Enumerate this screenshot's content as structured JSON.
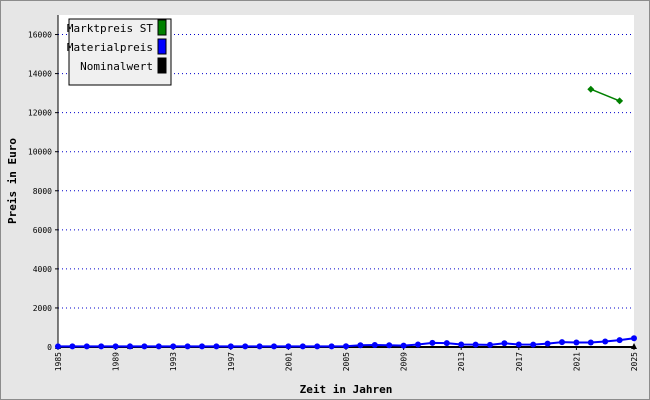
{
  "chart_data": {
    "type": "line",
    "title": "",
    "xlabel": "Zeit in Jahren",
    "ylabel": "Preis in Euro",
    "xlim": [
      1985,
      2025
    ],
    "ylim": [
      0,
      17000
    ],
    "x_ticks": [
      1985,
      1989,
      1993,
      1997,
      2001,
      2005,
      2009,
      2013,
      2017,
      2021,
      2025
    ],
    "y_ticks": [
      0,
      2000,
      4000,
      6000,
      8000,
      10000,
      12000,
      14000,
      16000
    ],
    "grid": "horizontal dotted",
    "legend_position": "top-left",
    "series": [
      {
        "name": "Marktpreis ST",
        "color": "#008000",
        "x": [
          2022,
          2024
        ],
        "values": [
          13200,
          12600
        ]
      },
      {
        "name": "Materialpreis",
        "color": "#0000ff",
        "x": [
          1985,
          1986,
          1987,
          1988,
          1989,
          1990,
          1991,
          1992,
          1993,
          1994,
          1995,
          1996,
          1997,
          1998,
          1999,
          2000,
          2001,
          2002,
          2003,
          2004,
          2005,
          2006,
          2007,
          2008,
          2009,
          2010,
          2011,
          2012,
          2013,
          2014,
          2015,
          2016,
          2017,
          2018,
          2019,
          2020,
          2021,
          2022,
          2023,
          2024,
          2025
        ],
        "values": [
          30,
          30,
          30,
          30,
          30,
          30,
          30,
          30,
          30,
          30,
          30,
          30,
          30,
          30,
          30,
          30,
          30,
          30,
          30,
          30,
          40,
          90,
          100,
          90,
          70,
          130,
          210,
          200,
          130,
          120,
          110,
          190,
          130,
          120,
          170,
          250,
          230,
          230,
          280,
          350,
          450
        ]
      },
      {
        "name": "Nominalwert",
        "color": "#000000",
        "x": [
          1985,
          1990,
          2025
        ],
        "values": [
          0,
          0,
          0
        ]
      }
    ]
  }
}
